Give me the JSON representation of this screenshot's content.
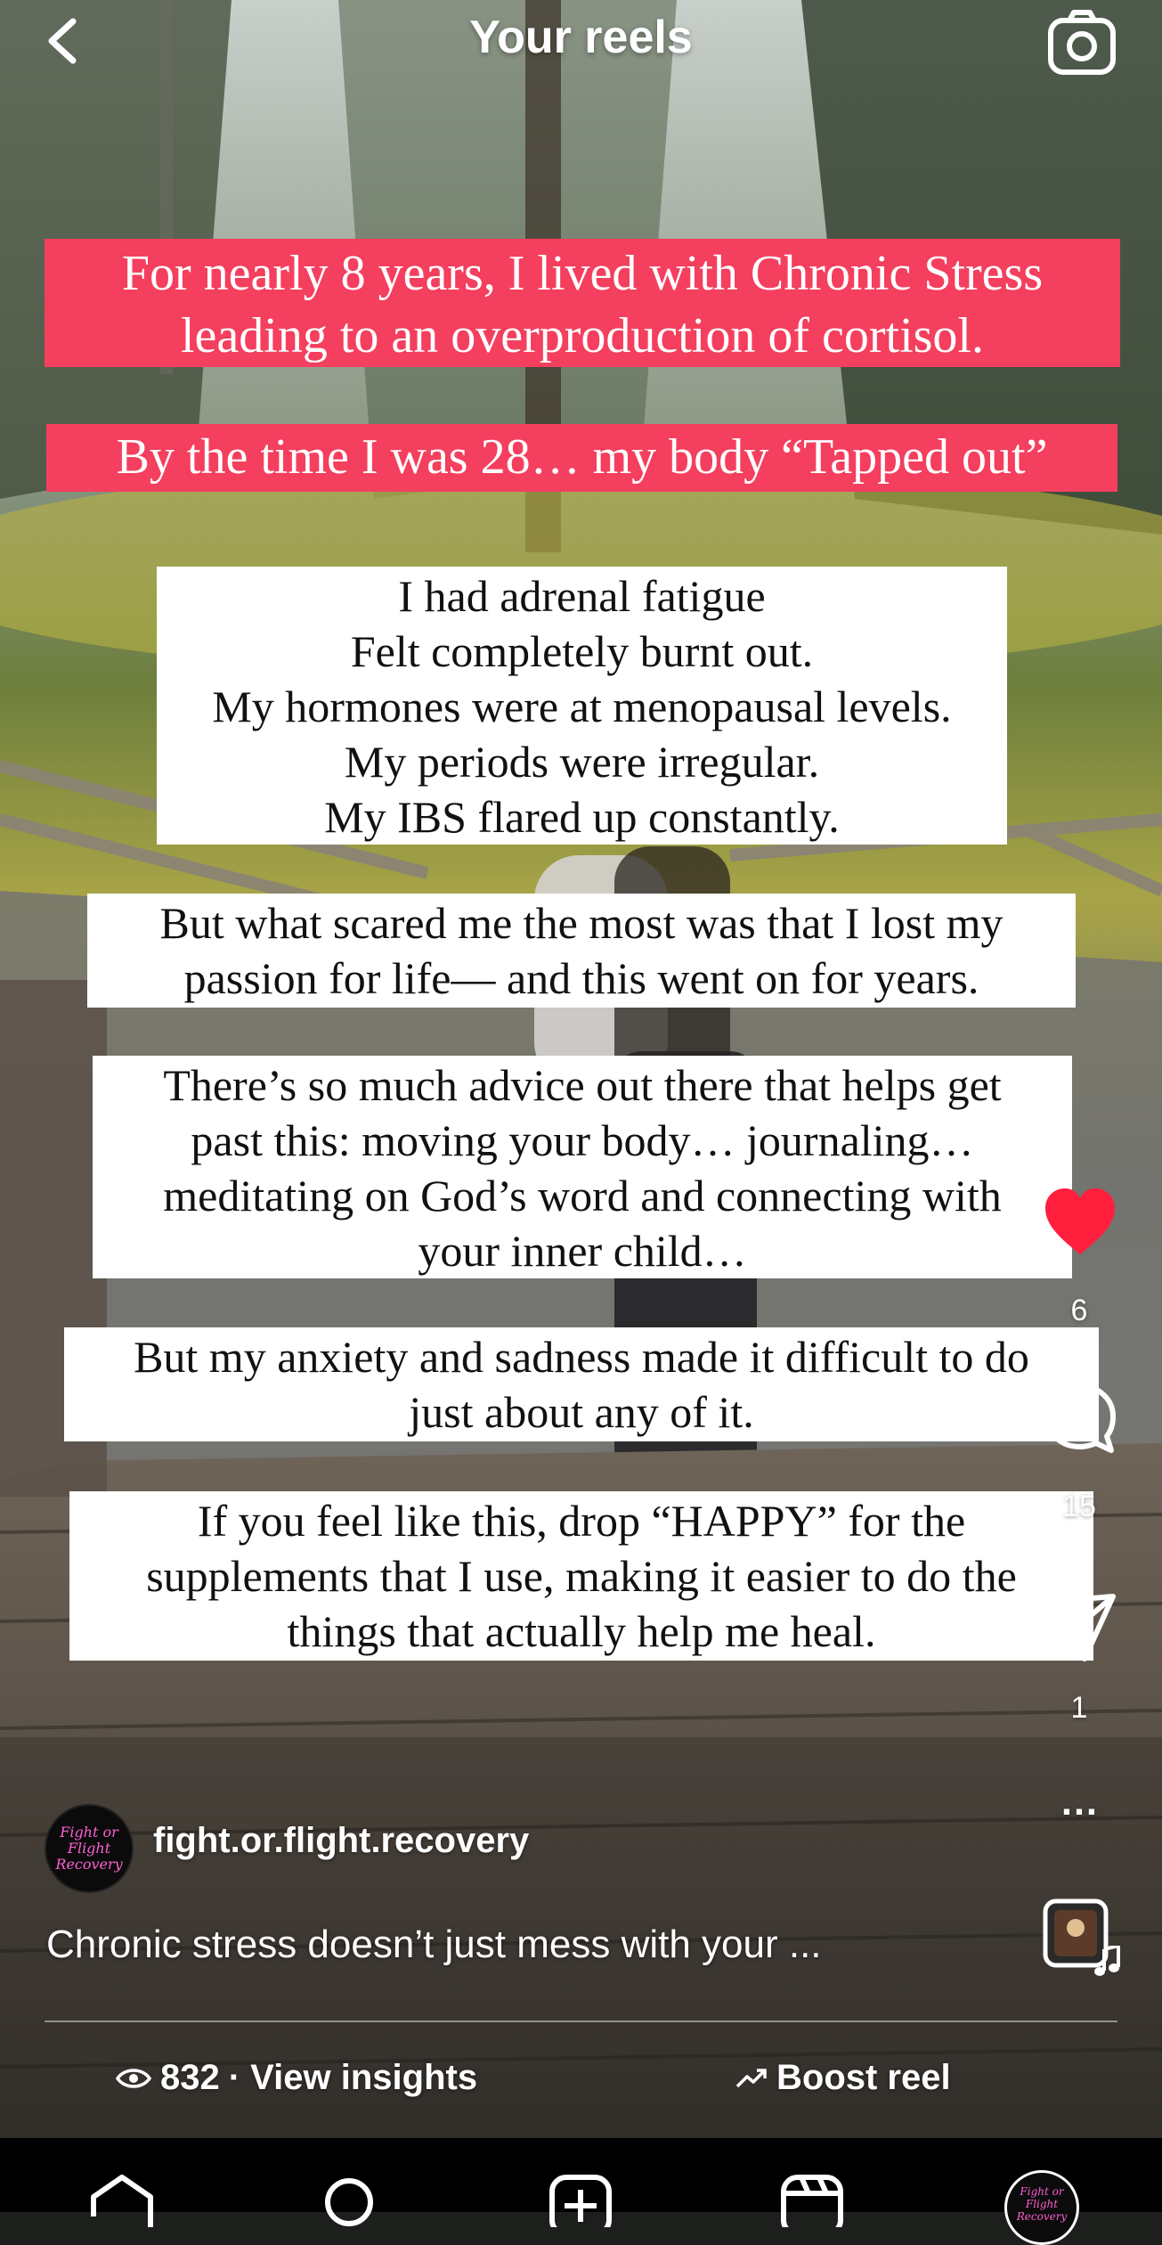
{
  "header": {
    "title": "Your reels"
  },
  "captions": {
    "red1": [
      "For nearly 8 years, I lived with Chronic Stress",
      "leading to an overproduction of cortisol."
    ],
    "red2": "By the time I was 28… my body “Tapped out”",
    "white1": [
      "I had adrenal fatigue",
      "Felt completely burnt out.",
      "My hormones were at menopausal levels.",
      "My periods were irregular.",
      "My IBS flared up constantly."
    ],
    "white2": [
      "But what scared me the most was that I lost my",
      "passion for life— and this went on for years."
    ],
    "white3": [
      "There’s so much advice out there that helps get",
      "past this: moving your body… journaling…",
      "meditating on God’s word and connecting with",
      "your inner child…"
    ],
    "white4": [
      "But my anxiety and sadness made it difficult to do",
      "just about any of it."
    ],
    "white5": [
      "If you feel like this, drop “HAPPY” for the",
      "supplements that I use, making it easier to do the",
      "things that actually help me heal."
    ]
  },
  "rail": {
    "likes": "6",
    "comments": "15",
    "shares": "1",
    "more": "…",
    "like_color": "#ff1f3d"
  },
  "author": {
    "avatar_text": "Fight or Flight Recovery",
    "username": "fight.or.flight.recovery"
  },
  "post_caption": "Chronic stress doesn’t just mess with your ...",
  "footer": {
    "views": "832",
    "insights_label": "· View insights",
    "boost_label": "Boost reel"
  },
  "profile_tab_text": "Fight or Flight Recovery",
  "icons": [
    "back-chevron-icon",
    "camera-icon",
    "heart-icon",
    "comment-icon",
    "share-icon",
    "more-icon",
    "music-note-icon",
    "eye-icon",
    "trend-up-icon",
    "home-icon",
    "search-icon",
    "create-icon",
    "reels-icon"
  ]
}
